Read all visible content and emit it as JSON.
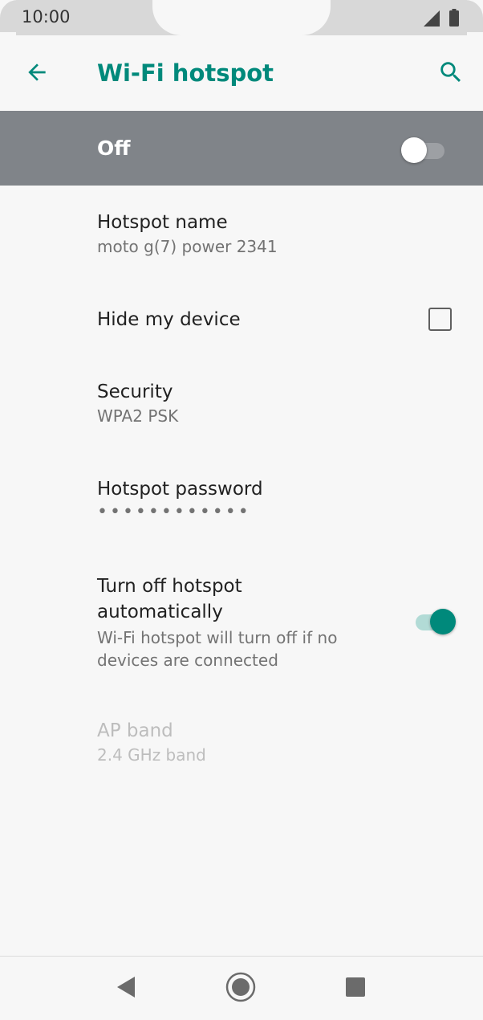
{
  "status_bar": {
    "time": "10:00",
    "icons": [
      "signal-icon",
      "battery-icon"
    ]
  },
  "app_bar": {
    "title": "Wi-Fi hotspot",
    "accent_color": "#00897b",
    "icons": [
      "back-arrow-icon",
      "search-icon"
    ]
  },
  "master_switch": {
    "label": "Off",
    "checked": false
  },
  "settings": {
    "hotspot_name": {
      "title": "Hotspot name",
      "value": "moto g(7) power 2341"
    },
    "hide_device": {
      "title": "Hide my device",
      "checked": false
    },
    "security": {
      "title": "Security",
      "value": "WPA2 PSK"
    },
    "password": {
      "title": "Hotspot password",
      "value": "••••••••••••"
    },
    "auto_off": {
      "title": "Turn off hotspot automatically",
      "summary": "Wi-Fi hotspot will turn off if no devices are connected",
      "checked": true
    },
    "ap_band": {
      "title": "AP band",
      "value": "2.4 GHz band",
      "enabled": false
    }
  },
  "nav_bar": {
    "icons": [
      "back-icon",
      "home-icon",
      "recents-icon"
    ]
  }
}
